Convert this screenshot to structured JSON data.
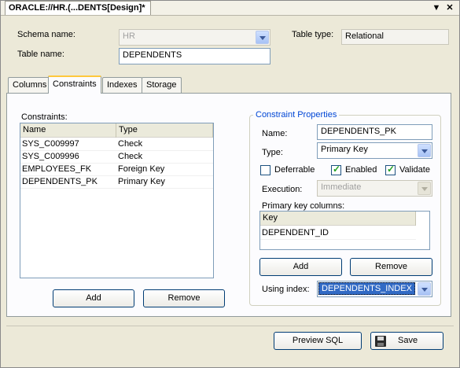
{
  "window": {
    "title": "ORACLE://HR.(...DENTS[Design]*",
    "menu_icon": "chevron-down-icon",
    "close_icon": "close-icon"
  },
  "form": {
    "schema_label": "Schema name:",
    "schema_value": "HR",
    "table_label": "Table name:",
    "table_value": "DEPENDENTS",
    "type_label": "Table type:",
    "type_value": "Relational"
  },
  "tabs": [
    {
      "label": "Columns"
    },
    {
      "label": "Constraints",
      "active": true
    },
    {
      "label": "Indexes"
    },
    {
      "label": "Storage"
    }
  ],
  "constraints": {
    "label": "Constraints:",
    "columns": [
      "Name",
      "Type"
    ],
    "rows": [
      {
        "name": "SYS_C009997",
        "type": "Check"
      },
      {
        "name": "SYS_C009996",
        "type": "Check"
      },
      {
        "name": "EMPLOYEES_FK",
        "type": "Foreign Key"
      },
      {
        "name": "DEPENDENTS_PK",
        "type": "Primary Key"
      }
    ],
    "add_label": "Add",
    "remove_label": "Remove"
  },
  "properties": {
    "title": "Constraint Properties",
    "name_label": "Name:",
    "name_value": "DEPENDENTS_PK",
    "type_label": "Type:",
    "type_value": "Primary Key",
    "deferrable_label": "Deferrable",
    "deferrable_checked": false,
    "enabled_label": "Enabled",
    "enabled_checked": true,
    "validate_label": "Validate",
    "validate_checked": true,
    "execution_label": "Execution:",
    "execution_value": "Immediate",
    "pk_columns_label": "Primary key columns:",
    "pk_header": "Key",
    "pk_rows": [
      "DEPENDENT_ID"
    ],
    "add_label": "Add",
    "remove_label": "Remove",
    "using_index_label": "Using index:",
    "using_index_value": "DEPENDENTS_INDEX"
  },
  "footer": {
    "preview_label": "Preview SQL",
    "save_label": "Save",
    "save_icon": "floppy-disk-icon"
  },
  "colors": {
    "selection": "#316ac5",
    "group_title": "#0046d5",
    "active_tab_accent": "#ffc83c"
  }
}
